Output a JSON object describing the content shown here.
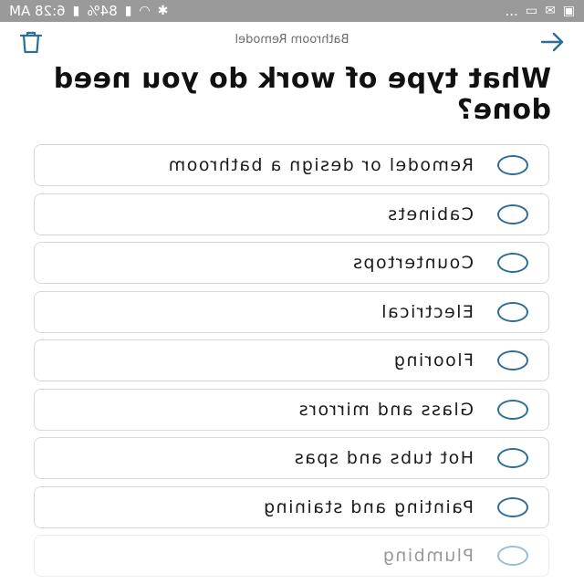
{
  "status_bar": {
    "time": "6:28 AM",
    "battery": "84%",
    "dots": "..."
  },
  "header": {
    "title": "Bathroom Remodel"
  },
  "question": "What type of work do you need done?",
  "options": [
    {
      "label": "Remodel or design a bathroom"
    },
    {
      "label": "Cabinets"
    },
    {
      "label": "Countertops"
    },
    {
      "label": "Electrical"
    },
    {
      "label": "Flooring"
    },
    {
      "label": "Glass and mirrors"
    },
    {
      "label": "Hot tubs and spas"
    },
    {
      "label": "Painting and staining"
    },
    {
      "label": "Plumbing"
    }
  ],
  "colors": {
    "accent": "#2b6e98",
    "status_bar": "#9a9a9a",
    "border": "#d8d8d8"
  }
}
